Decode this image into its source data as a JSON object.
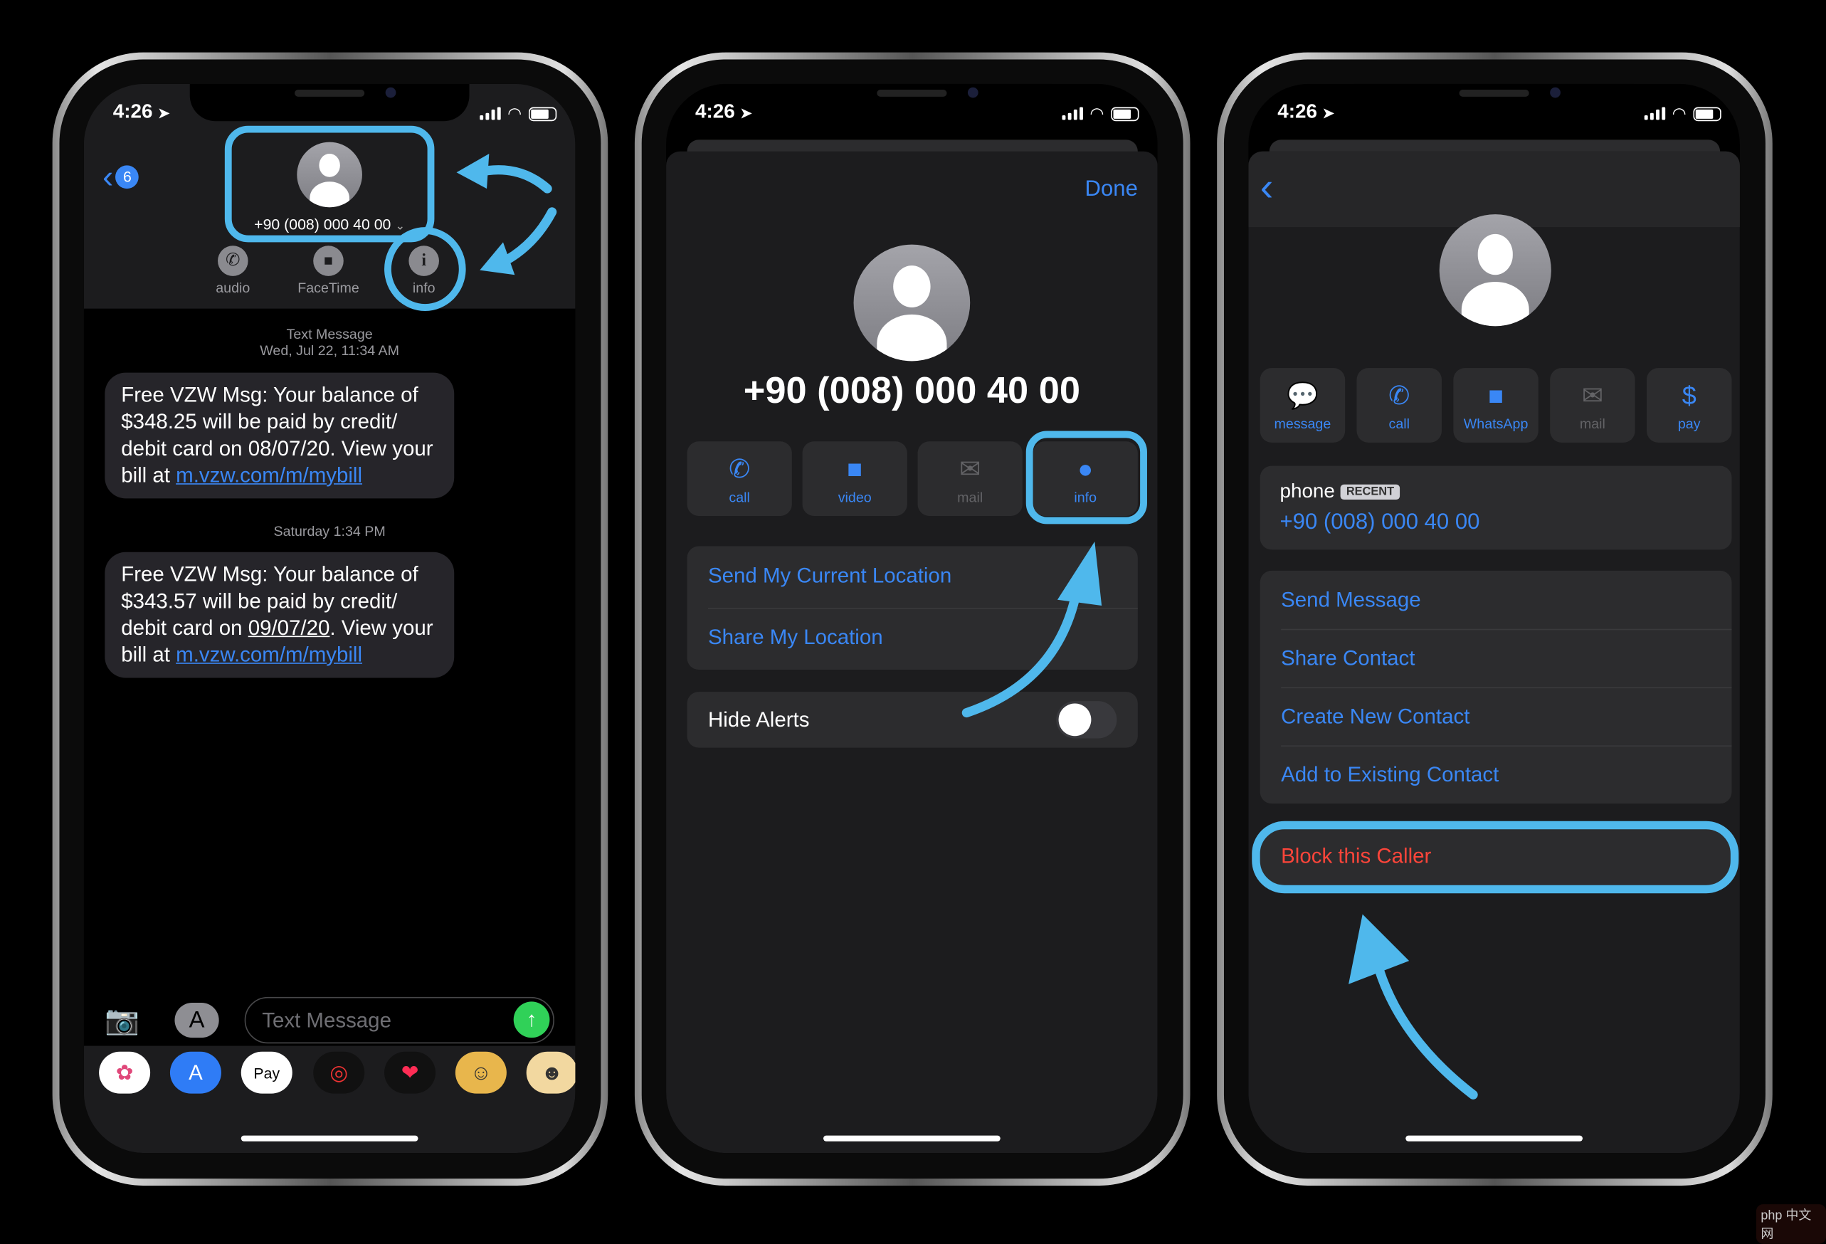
{
  "accent": "#3a87f5",
  "highlight": "#4fb8ec",
  "danger": "#ff453a",
  "status": {
    "time": "4:26",
    "location_glyph": "➤"
  },
  "phone1": {
    "back_badge": "6",
    "contact_number": "+90 (008) 000 40 00",
    "chevron": "⌄",
    "actions": [
      {
        "label": "audio",
        "icon": "phone-icon"
      },
      {
        "label": "FaceTime",
        "icon": "video-icon"
      },
      {
        "label": "info",
        "icon": "info-icon"
      }
    ],
    "stamp1_title": "Text Message",
    "stamp1_date": "Wed, Jul 22, 11:34 AM",
    "msg1": {
      "text": "Free VZW Msg: Your balance of $348.25 will be paid by credit/ debit card on 08/07/20. View your bill at ",
      "link": "m.vzw.com/m/mybill"
    },
    "stamp2": "Saturday 1:34 PM",
    "msg2": {
      "text": "Free VZW Msg: Your balance of $343.57 will be paid by credit/ debit card on ",
      "date": "09/07/20",
      ". View your bill at ": "",
      "text2": ". View your bill at ",
      "link": "m.vzw.com/m/mybill"
    },
    "input_placeholder": "Text Message",
    "apps": [
      {
        "name": "photos",
        "glyph": "✿"
      },
      {
        "name": "app-store",
        "glyph": "A"
      },
      {
        "name": "apple-pay",
        "glyph": "Pay"
      },
      {
        "name": "activity",
        "glyph": "◎"
      },
      {
        "name": "digital-touch",
        "glyph": "❤"
      },
      {
        "name": "memoji",
        "glyph": "☺"
      },
      {
        "name": "memoji-2",
        "glyph": "☻"
      }
    ]
  },
  "phone2": {
    "done": "Done",
    "number": "+90 (008) 000 40 00",
    "tiles": [
      {
        "label": "call",
        "glyph": "✆"
      },
      {
        "label": "video",
        "glyph": "■"
      },
      {
        "label": "mail",
        "glyph": "✉"
      },
      {
        "label": "info",
        "glyph": "●"
      }
    ],
    "location_rows": [
      "Send My Current Location",
      "Share My Location"
    ],
    "hide_alerts": "Hide Alerts",
    "hide_alerts_on": false
  },
  "phone3": {
    "tiles": [
      {
        "label": "message",
        "glyph": "💬"
      },
      {
        "label": "call",
        "glyph": "✆"
      },
      {
        "label": "WhatsApp",
        "glyph": "■"
      },
      {
        "label": "mail",
        "glyph": "✉"
      },
      {
        "label": "pay",
        "glyph": "$"
      }
    ],
    "phone_label": "phone",
    "recent_badge": "RECENT",
    "number": "+90 (008) 000 40 00",
    "actions": [
      "Send Message",
      "Share Contact",
      "Create New Contact",
      "Add to Existing Contact"
    ],
    "block": "Block this Caller"
  },
  "watermark": "php 中文网"
}
